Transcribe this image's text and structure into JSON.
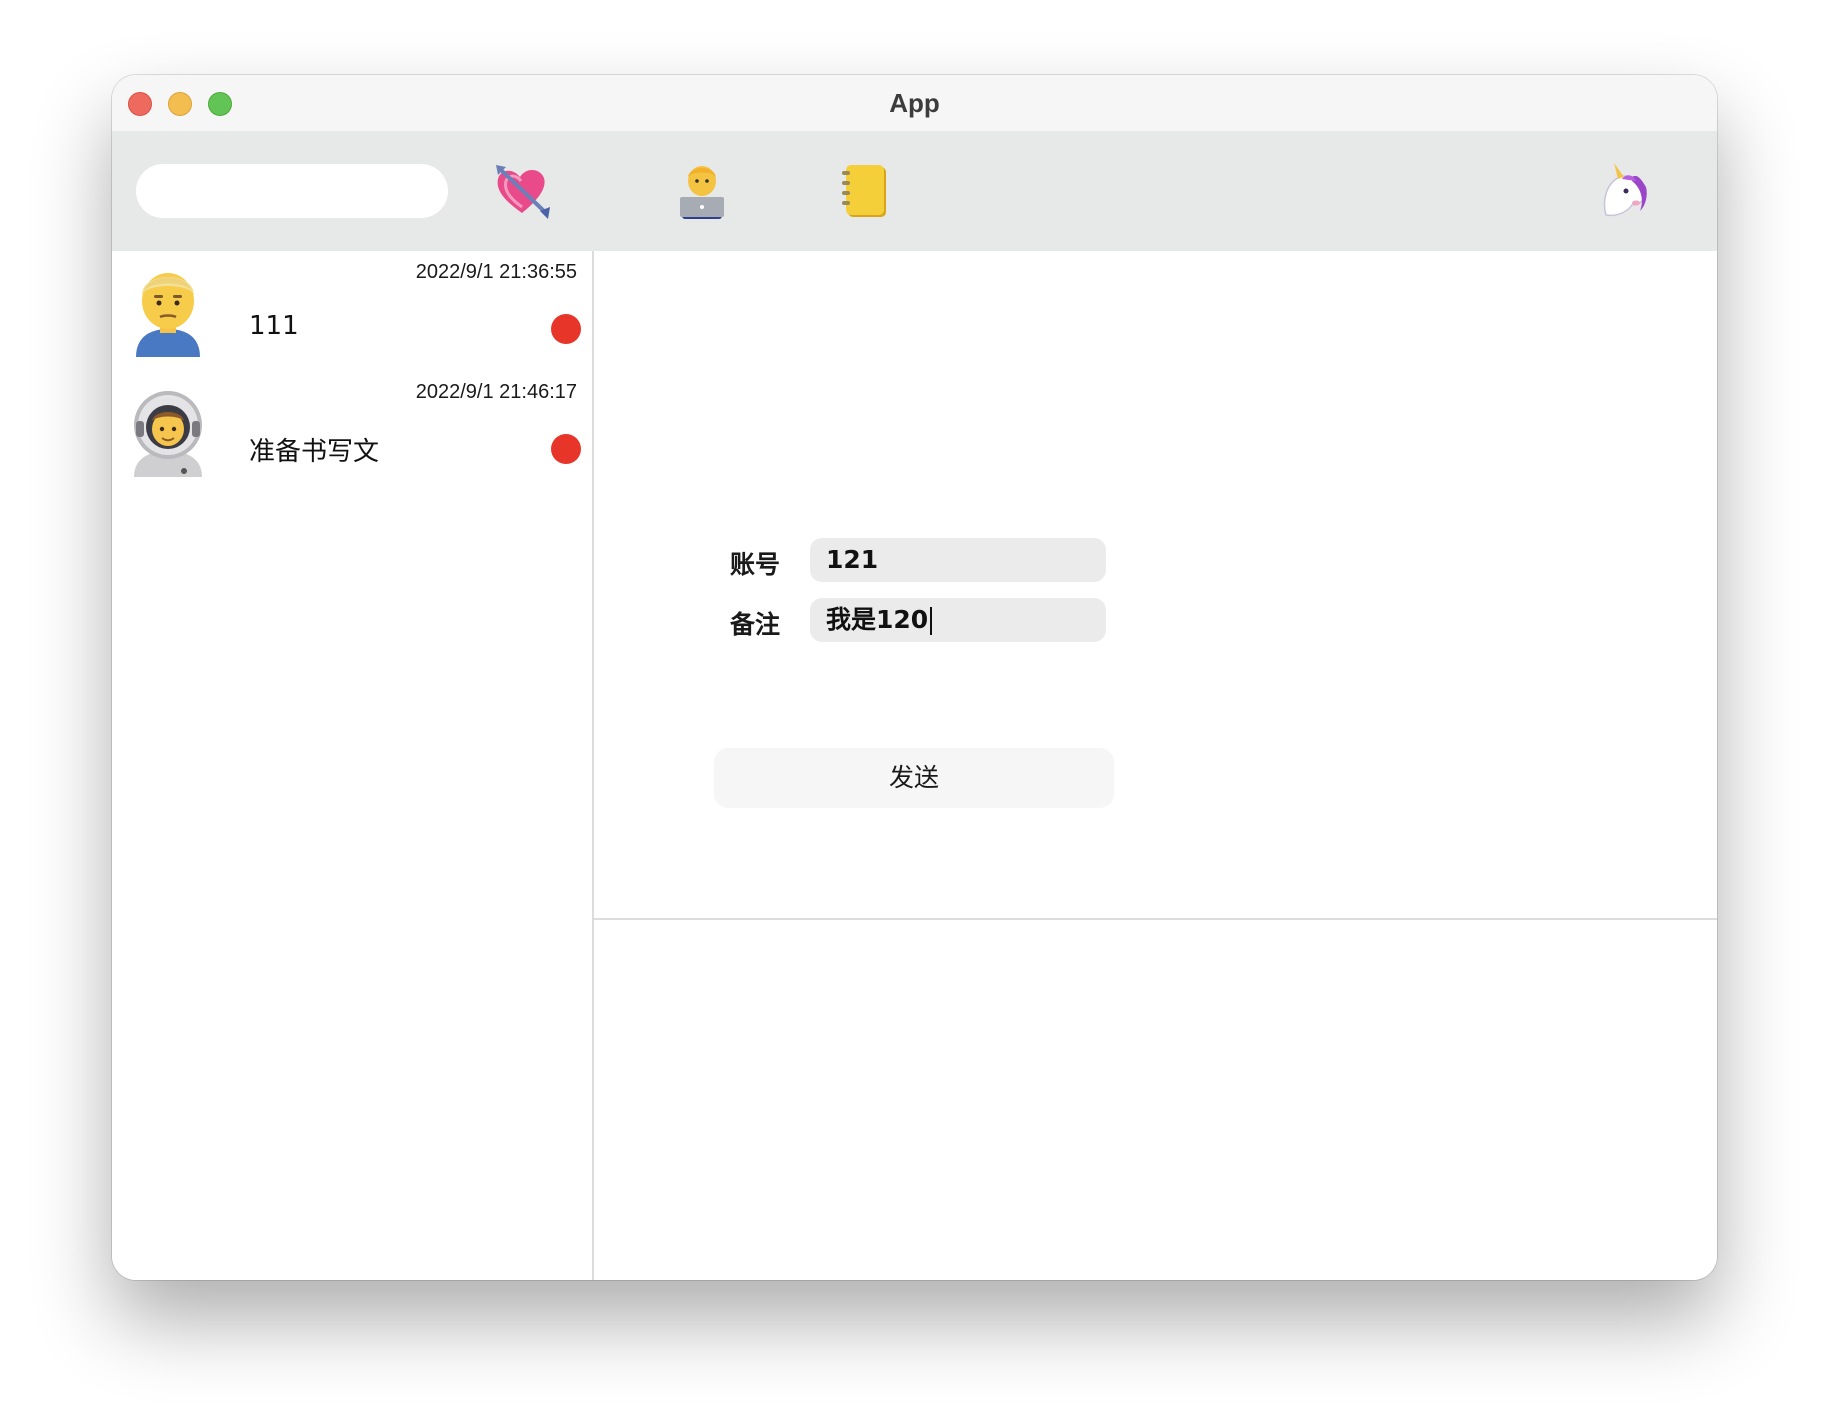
{
  "window": {
    "title": "App"
  },
  "toolbar": {
    "search": {
      "value": "",
      "placeholder": ""
    },
    "icons": [
      "heart-with-arrow-icon",
      "technologist-icon",
      "notebook-icon",
      "unicorn-icon"
    ]
  },
  "chats": [
    {
      "avatar": "man-blond-avatar",
      "time": "2022/9/1 21:36:55",
      "message": "111",
      "unread": true
    },
    {
      "avatar": "astronaut-avatar",
      "time": "2022/9/1 21:46:17",
      "message": "准备书写文",
      "unread": true
    }
  ],
  "form": {
    "account_label": "账号",
    "account_value": "121",
    "note_label": "备注",
    "note_value": "我是120",
    "send_label": "发送"
  },
  "colors": {
    "unread_dot": "#e8352a",
    "toolbar_bg": "#e7e8e8",
    "field_bg": "#ebebeb"
  }
}
